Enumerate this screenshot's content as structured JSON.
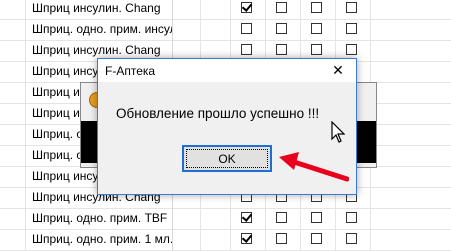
{
  "grid": {
    "rows": [
      {
        "name": "Шприц инсулин. Chang",
        "checks": [
          true,
          false,
          false,
          false
        ],
        "dimmed": false
      },
      {
        "name": "Шприц. одно. прим. инсул",
        "checks": [
          false,
          false,
          false,
          false
        ],
        "dimmed": true
      },
      {
        "name": "Шприц инсулин. Chang",
        "checks": [
          false,
          false,
          false,
          false
        ],
        "dimmed": true
      },
      {
        "name": "Шприц инсулин. Chang",
        "checks": [
          false,
          false,
          false,
          false
        ],
        "dimmed": true
      },
      {
        "name": "Шприц инсулин. Chang",
        "checks": [
          false,
          false,
          false,
          false
        ],
        "dimmed": true
      },
      {
        "name": "Шприц инсулин. Chang",
        "checks": [
          false,
          false,
          false,
          false
        ],
        "dimmed": true
      },
      {
        "name": "Шприц. одно. прим. инсул",
        "checks": [
          false,
          false,
          false,
          false
        ],
        "dimmed": true
      },
      {
        "name": "Шприц. одно. прим. инсул",
        "checks": [
          false,
          false,
          false,
          false
        ],
        "dimmed": true
      },
      {
        "name": "Шприц инсулин. Chang",
        "checks": [
          false,
          false,
          false,
          false
        ],
        "dimmed": true
      },
      {
        "name": "Шприц инсулин. Chang",
        "checks": [
          false,
          false,
          false,
          false
        ],
        "dimmed": true
      },
      {
        "name": "Шприц. одно. прим. TBF",
        "checks": [
          true,
          false,
          false,
          false
        ],
        "dimmed": false
      },
      {
        "name": "Шприц. одно. прим. 1 мл.",
        "checks": [
          true,
          false,
          false,
          false
        ],
        "dimmed": false
      }
    ]
  },
  "dialog": {
    "title": "F-Аптека",
    "close_glyph": "✕",
    "message": "Обновление прошло успешно !!!",
    "ok_label": "OK"
  },
  "colors": {
    "arrow": "#e8001c",
    "dialog_border": "#3a7bd5",
    "ok_border": "#1f6fd0"
  }
}
